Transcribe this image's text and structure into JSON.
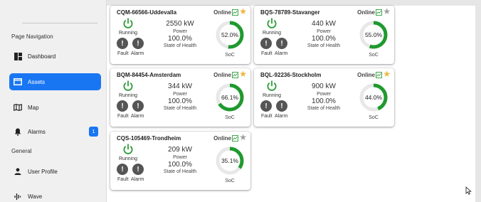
{
  "sidebar": {
    "section_nav": "Page Navigation",
    "section_general": "General",
    "items": [
      {
        "label": "Dashboard",
        "icon": "dashboard-icon"
      },
      {
        "label": "Assets",
        "icon": "assets-icon",
        "active": true
      },
      {
        "label": "Map",
        "icon": "map-icon"
      },
      {
        "label": "Alarms",
        "icon": "bell-icon",
        "badge": "1"
      },
      {
        "label": "User Profile",
        "icon": "user-icon"
      },
      {
        "label": "Wave",
        "icon": "wave-icon"
      }
    ]
  },
  "colors": {
    "accent": "#1976f2",
    "gauge_fill": "#1f9a2e",
    "gauge_track": "#e8e8e8",
    "power_green": "#2e9d3a",
    "star_on": "#f0b43c",
    "star_off": "#9e9e9e",
    "alert_gray": "#555555"
  },
  "labels": {
    "running": "Running",
    "fault": "Fault",
    "alarm": "Alarm",
    "power": "Power",
    "soh": "State of Health",
    "soc": "SoC"
  },
  "cards": [
    {
      "name": "CQM-66566-Uddevalla",
      "status": "Online",
      "favorite": true,
      "power": "2550 kW",
      "soh": "100.0%",
      "soc_text": "52.0%",
      "soc": 0.52
    },
    {
      "name": "BQS-78789-Stavanger",
      "status": "Online",
      "favorite": false,
      "power": "440 kW",
      "soh": "100.0%",
      "soc_text": "55.0%",
      "soc": 0.55
    },
    {
      "name": "BQM-84454-Amsterdam",
      "status": "Online",
      "favorite": true,
      "power": "344 kW",
      "soh": "100.0%",
      "soc_text": "66.1%",
      "soc": 0.661
    },
    {
      "name": "BQL-92236-Stockholm",
      "status": "Online",
      "favorite": true,
      "power": "900 kW",
      "soh": "100.0%",
      "soc_text": "44.0%",
      "soc": 0.44
    },
    {
      "name": "CQS-105469-Trondheim",
      "status": "Online",
      "favorite": false,
      "power": "209 kW",
      "soh": "100.0%",
      "soc_text": "35.1%",
      "soc": 0.351
    }
  ]
}
